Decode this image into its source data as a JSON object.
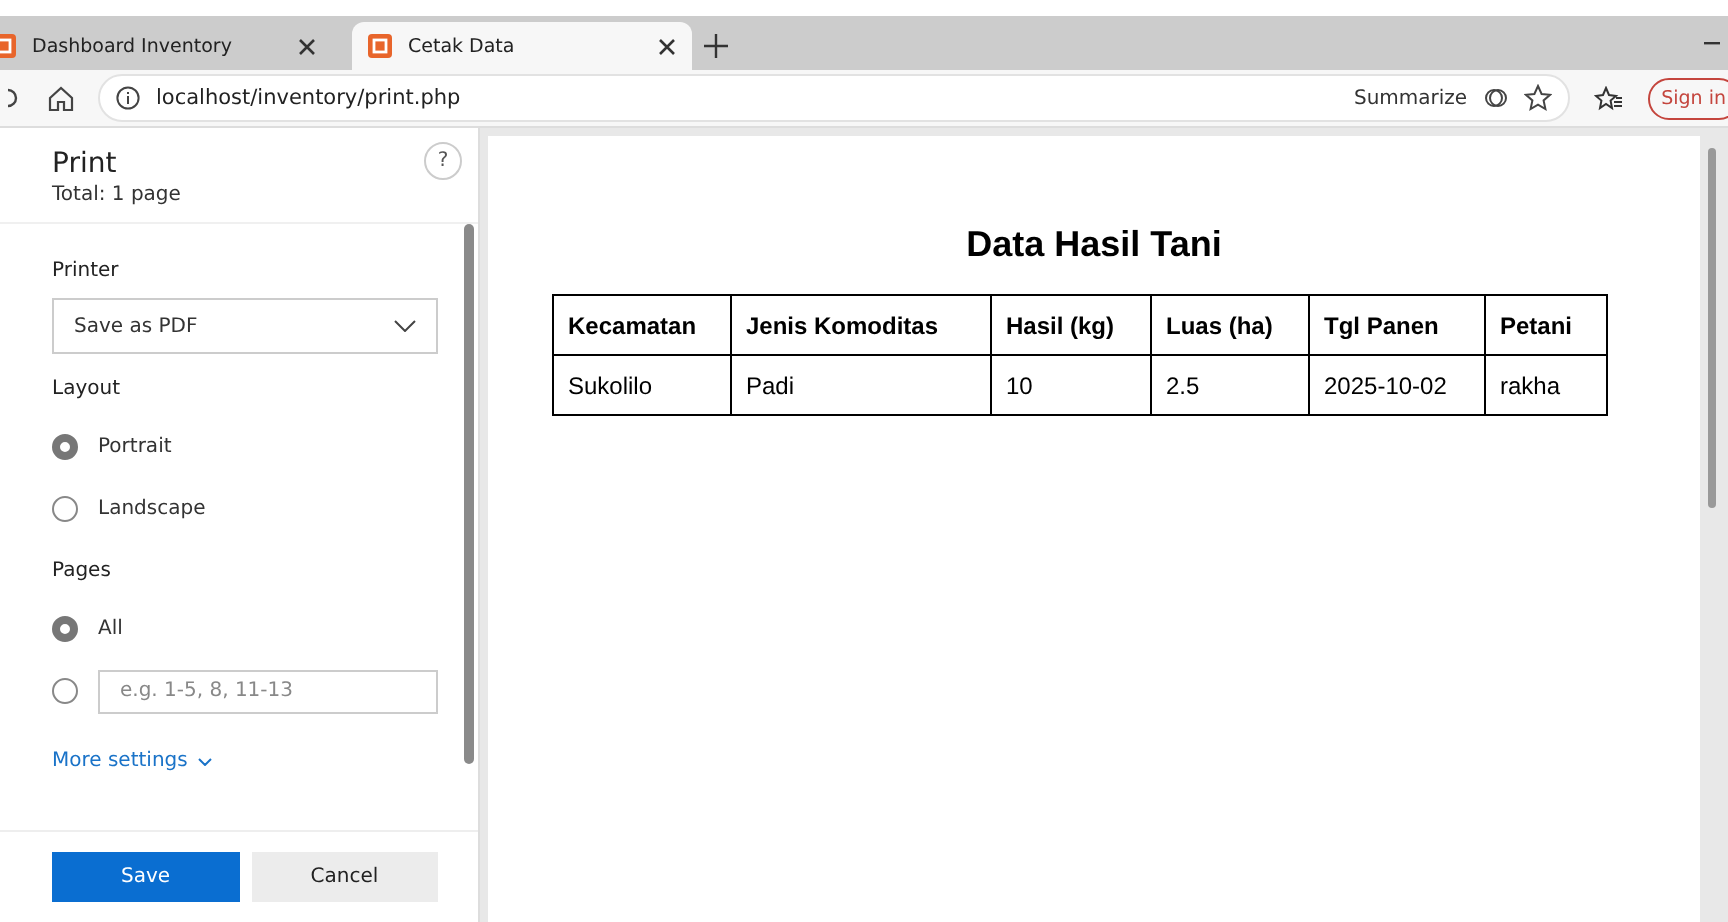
{
  "tabs": [
    {
      "title": "Dashboard Inventory",
      "selected": false
    },
    {
      "title": "Cetak Data",
      "selected": true
    }
  ],
  "address_bar": {
    "url": "localhost/inventory/print.php",
    "summarize": "Summarize",
    "sign_in": "Sign in"
  },
  "print_panel": {
    "title": "Print",
    "total": "Total: 1 page",
    "help": "?",
    "printer_label": "Printer",
    "printer": "Save as PDF",
    "layout_label": "Layout",
    "layout_options": [
      {
        "label": "Portrait",
        "selected": true
      },
      {
        "label": "Landscape",
        "selected": false
      }
    ],
    "pages_label": "Pages",
    "pages_options": [
      {
        "kind": "label",
        "label": "All",
        "selected": true
      },
      {
        "kind": "input",
        "placeholder": "e.g. 1-5, 8, 11-13",
        "selected": false
      }
    ],
    "more_settings": "More settings",
    "buttons": [
      "Save",
      "Cancel"
    ]
  },
  "document": {
    "title": "Data Hasil Tani",
    "table": {
      "columns": [
        "Kecamatan",
        "Jenis Komoditas",
        "Hasil (kg)",
        "Luas (ha)",
        "Tgl Panen",
        "Petani"
      ],
      "rows": [
        [
          "Sukolilo",
          "Padi",
          "10",
          "2.5",
          "2025-10-02",
          "rakha"
        ]
      ]
    }
  }
}
